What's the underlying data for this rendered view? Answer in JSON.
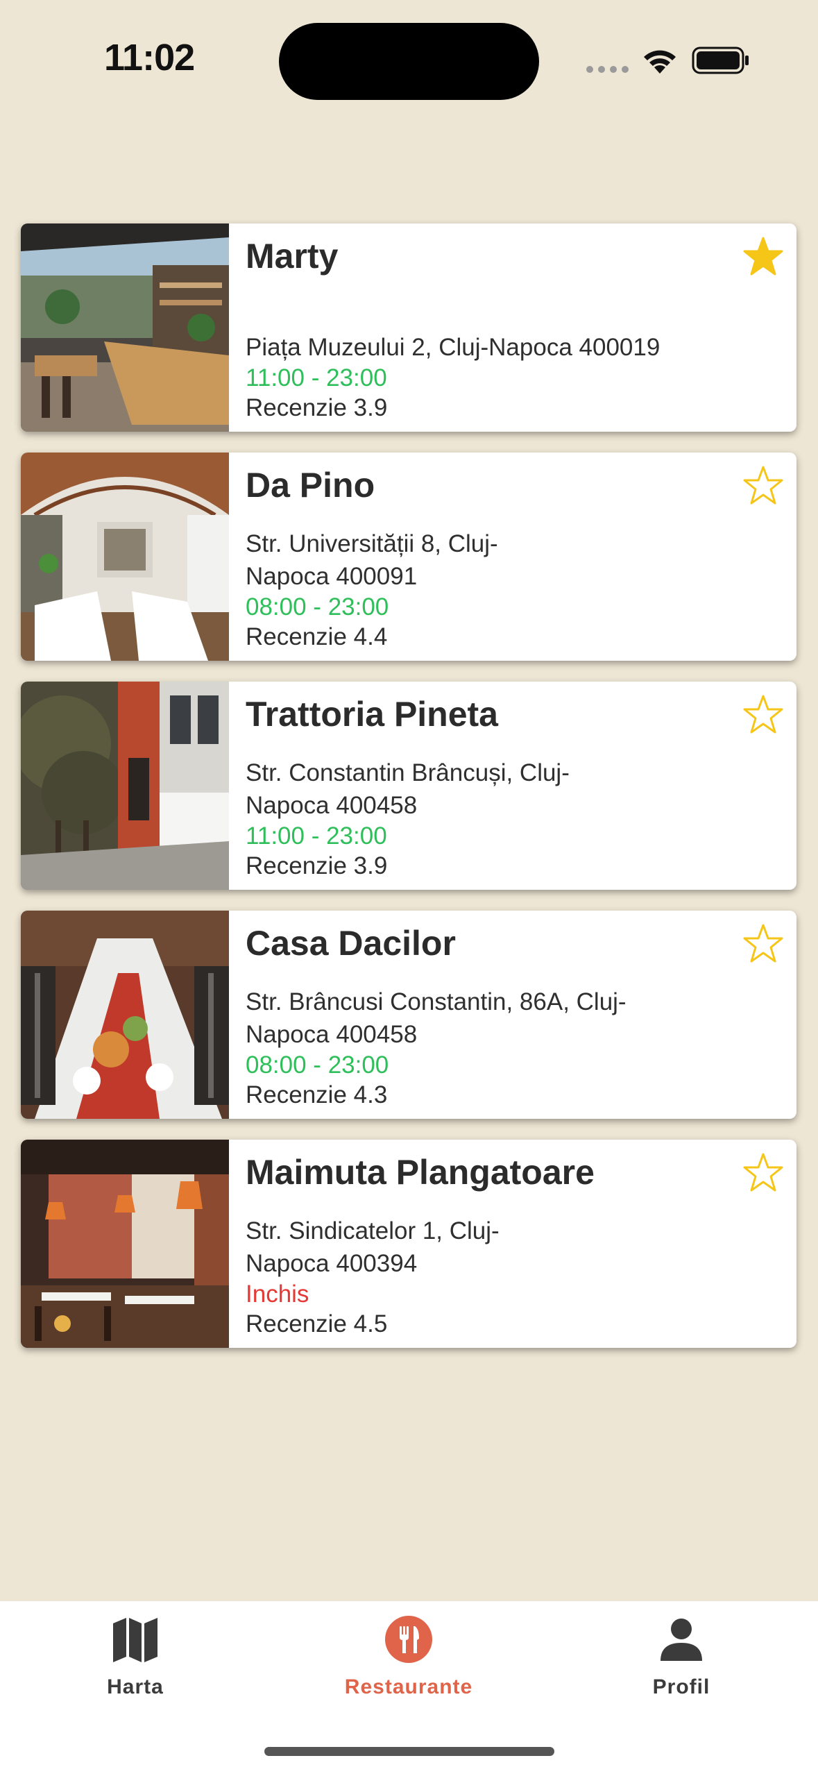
{
  "status_bar": {
    "time": "11:02"
  },
  "colors": {
    "background": "#EEE6D4",
    "open_hours": "#2FBF5A",
    "closed": "#E53935",
    "star": "#F5C518",
    "active_tab": "#E0644A"
  },
  "restaurants": [
    {
      "name": "Marty",
      "address": "Piața Muzeului 2, Cluj-Napoca 400019",
      "hours": "11:00 - 23:00",
      "rating": "Recenzie 3.9",
      "favorite": true,
      "open": true,
      "photo_icon": "restaurant-interior-photo"
    },
    {
      "name": "Da Pino",
      "address": "Str. Universității 8, Cluj-Napoca 400091",
      "hours": "08:00 - 23:00",
      "rating": "Recenzie 4.4",
      "favorite": false,
      "open": true,
      "photo_icon": "restaurant-vaulted-interior-photo"
    },
    {
      "name": "Trattoria Pineta",
      "address": "Str. Constantin Brâncuși, Cluj-Napoca 400458",
      "hours": "11:00 - 23:00",
      "rating": "Recenzie 3.9",
      "favorite": false,
      "open": true,
      "photo_icon": "restaurant-exterior-photo"
    },
    {
      "name": "Casa Dacilor",
      "address": "Str. Brâncusi Constantin, 86A, Cluj-Napoca 400458",
      "hours": "08:00 - 23:00",
      "rating": "Recenzie 4.3",
      "favorite": false,
      "open": true,
      "photo_icon": "set-table-photo"
    },
    {
      "name": "Maimuta Plangatoare",
      "address": "Str. Sindicatelor 1, Cluj-Napoca 400394",
      "hours": "Inchis",
      "rating": "Recenzie 4.5",
      "favorite": false,
      "open": false,
      "photo_icon": "pub-interior-photo"
    }
  ],
  "tab_bar": {
    "tabs": [
      {
        "label": "Harta",
        "icon": "map-icon",
        "active": false
      },
      {
        "label": "Restaurante",
        "icon": "fork-knife-icon",
        "active": true
      },
      {
        "label": "Profil",
        "icon": "person-icon",
        "active": false
      }
    ]
  }
}
